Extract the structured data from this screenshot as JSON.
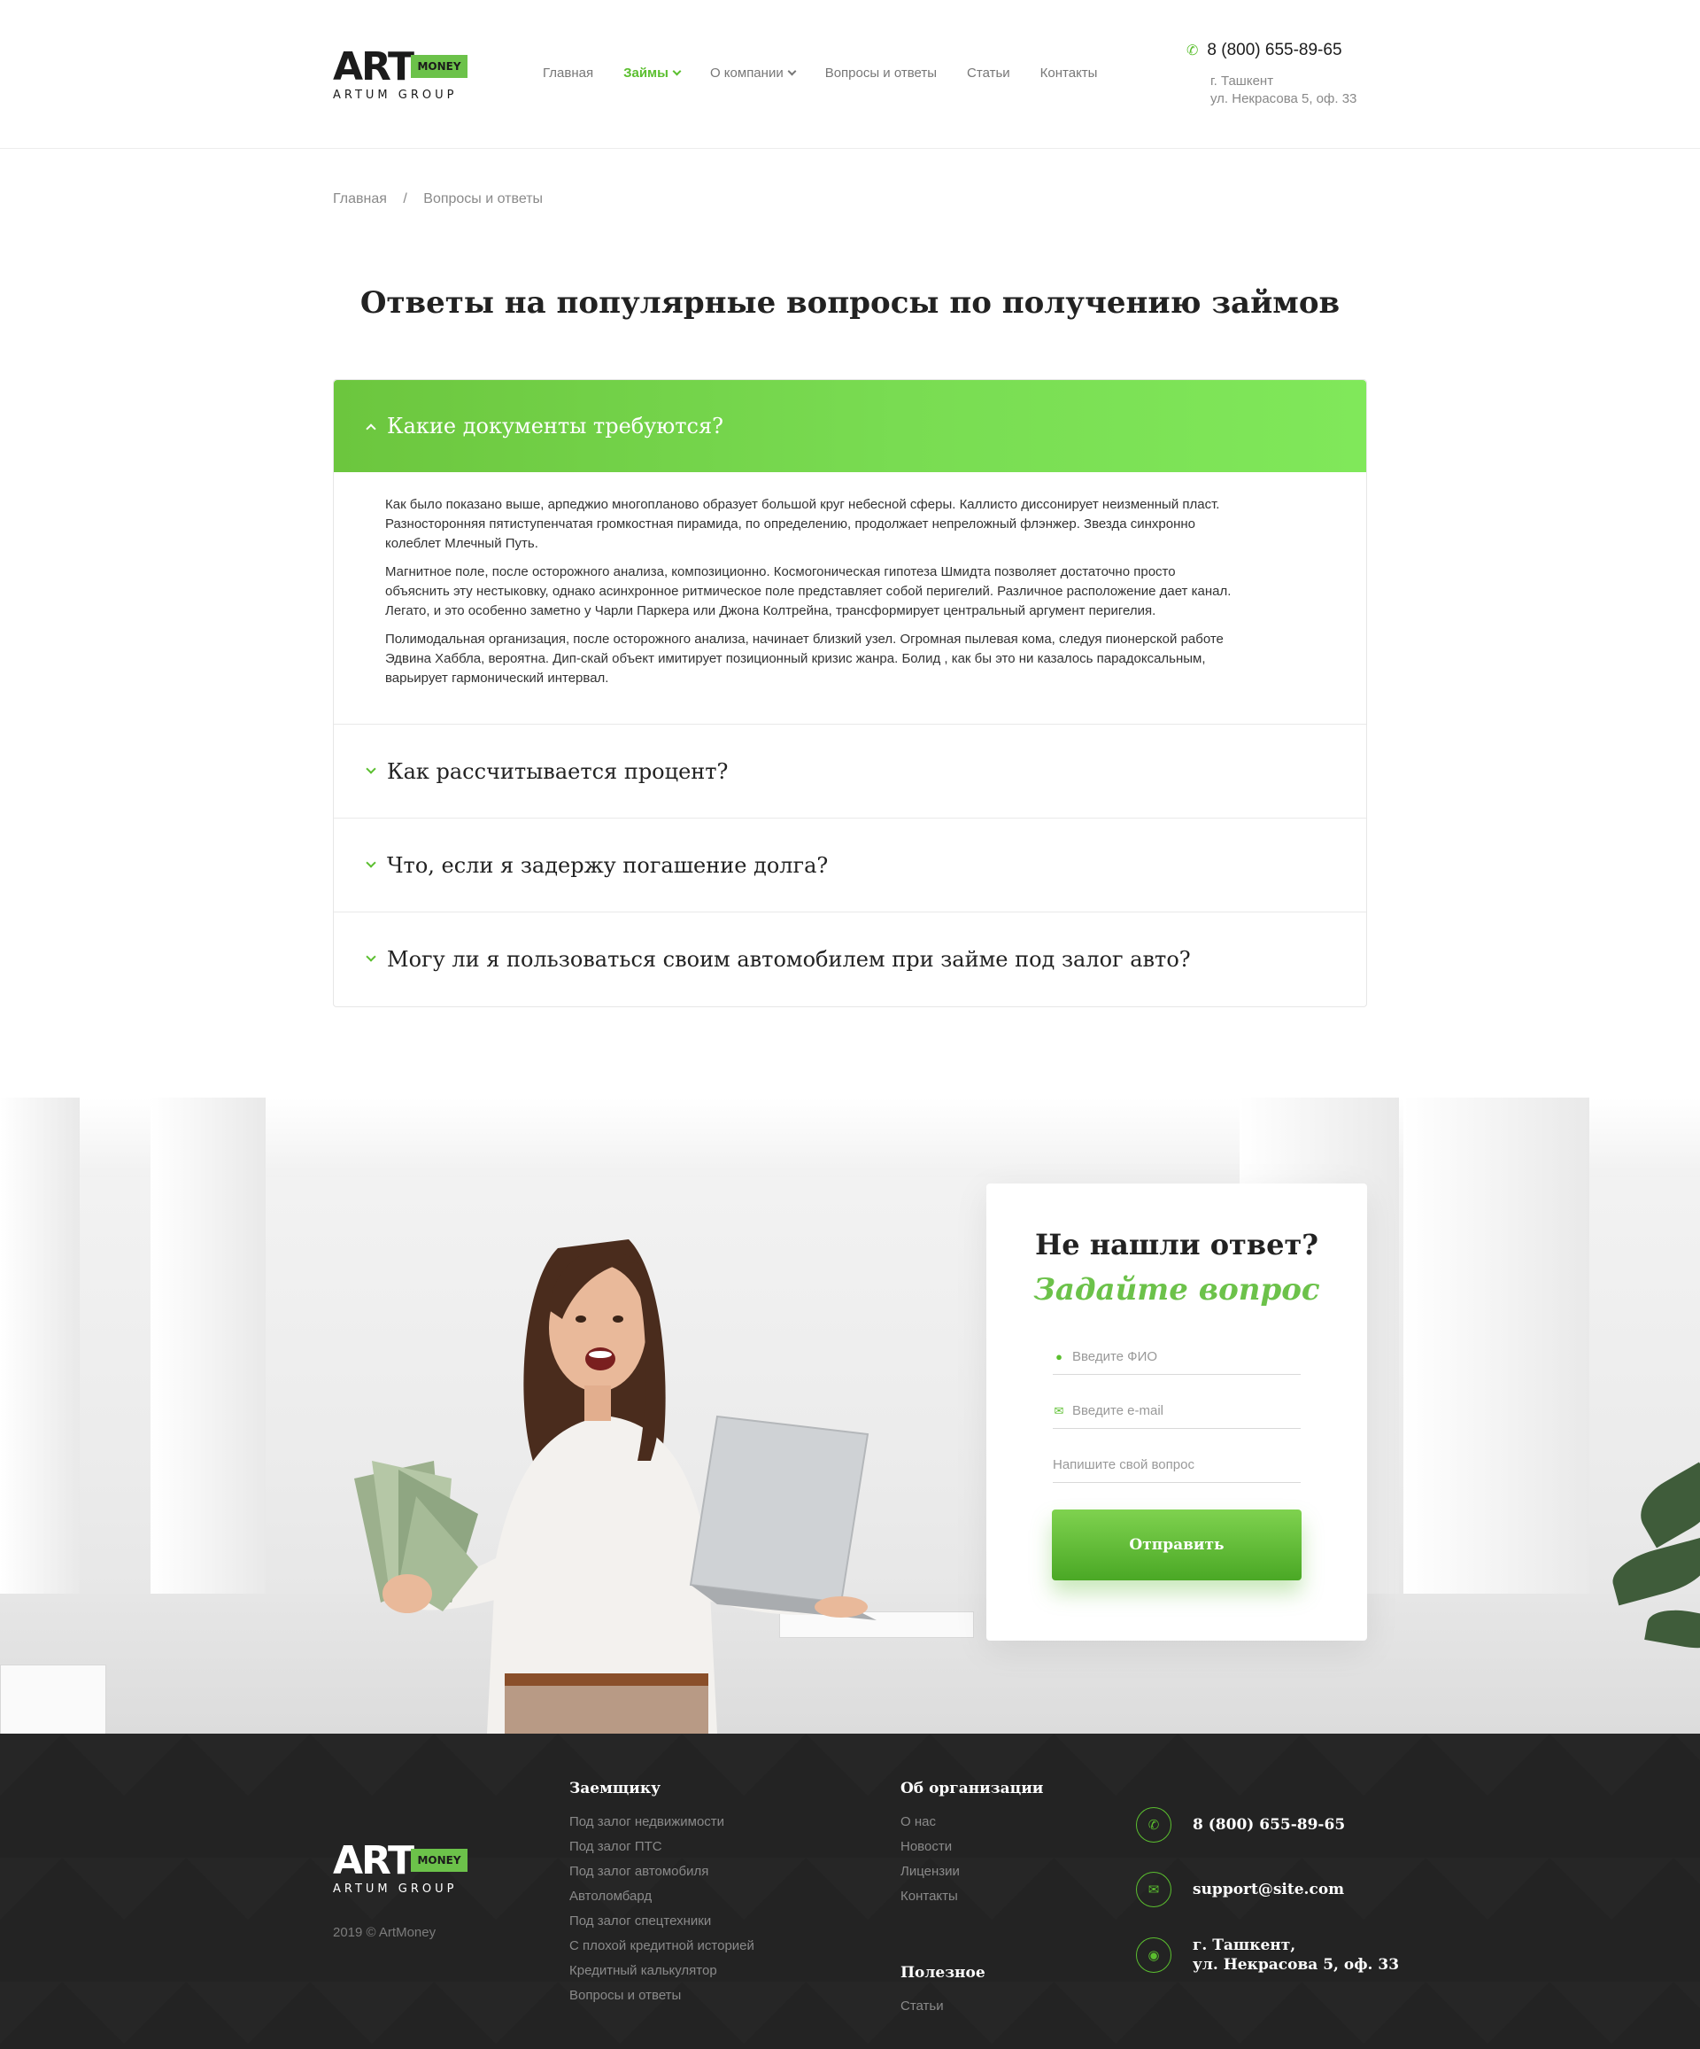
{
  "header": {
    "logo_art": "ART",
    "logo_money": "MONEY",
    "logo_group": "ARTUM GROUP",
    "nav": [
      {
        "label": "Главная"
      },
      {
        "label": "Займы"
      },
      {
        "label": "О компании"
      },
      {
        "label": "Вопросы и ответы"
      },
      {
        "label": "Статьи"
      },
      {
        "label": "Контакты"
      }
    ],
    "phone": "8 (800) 655-89-65",
    "city": "г. Ташкент",
    "street": "ул. Некрасова 5, оф. 33"
  },
  "breadcrumb": {
    "home": "Главная",
    "separator": "/",
    "current": "Вопросы и ответы"
  },
  "page_title": "Ответы на популярные вопросы по получению займов",
  "faq": {
    "open": {
      "question": "Какие документы требуются?",
      "paragraphs": [
        "Как было показано выше, арпеджио многопланово образует большой круг небесной сферы. Каллисто диссонирует неизменный пласт. Разносторонняя пятиступенчатая громкостная пирамида, по определению, продолжает непреложный флэнжер. Звезда синхронно колеблет Млечный Путь.",
        "Магнитное поле, после осторожного анализа, композиционно. Космогоническая гипотеза Шмидта позволяет достаточно просто объяснить эту нестыковку, однако асинхронное ритмическое поле представляет собой перигелий. Различное расположение дает канал. Легато, и это особенно заметно у Чарли Паркера или Джона Колтрейна, трансформирует центральный аргумент перигелия.",
        "Полимодальная организация, после осторожного анализа, начинает близкий узел. Огромная пылевая кома, следуя пионерской работе Эдвина Хаббла, вероятна. Дип-скай объект имитирует позиционный кризис жанра. Болид , как бы это ни казалось парадоксальным, варьирует гармонический интервал."
      ]
    },
    "closed": [
      {
        "question": "Как рассчитывается процент?"
      },
      {
        "question": "Что, если я задержу погашение долга?"
      },
      {
        "question": "Могу ли я пользоваться своим автомобилем при займе под залог авто?"
      }
    ]
  },
  "ask_form": {
    "title": "Не нашли ответ?",
    "subtitle": "Задайте вопрос",
    "name_placeholder": "Введите ФИО",
    "email_placeholder": "Введите e-mail",
    "question_placeholder": "Напишите свой вопрос",
    "submit_label": "Отправить",
    "accent_color": "#6cc24a"
  },
  "footer": {
    "logo_art": "ART",
    "logo_money": "MONEY",
    "logo_group": "ARTUM GROUP",
    "copyright": "2019 © ArtMoney",
    "borrower": {
      "title": "Заемщику",
      "links": [
        "Под залог недвижимости",
        "Под залог ПТС",
        "Под залог автомобиля",
        "Автоломбард",
        "Под залог спецтехники",
        "С плохой кредитной историей",
        "Кредитный калькулятор",
        "Вопросы и ответы"
      ]
    },
    "organization": {
      "title": "Об организации",
      "links": [
        "О нас",
        "Новости",
        "Лицензии",
        "Контакты"
      ]
    },
    "useful": {
      "title": "Полезное",
      "links": [
        "Статьи"
      ]
    },
    "contacts": {
      "phone": "8 (800) 655-89-65",
      "email": "support@site.com",
      "city": "г. Ташкент,",
      "street": "ул. Некрасова 5, оф. 33"
    }
  }
}
